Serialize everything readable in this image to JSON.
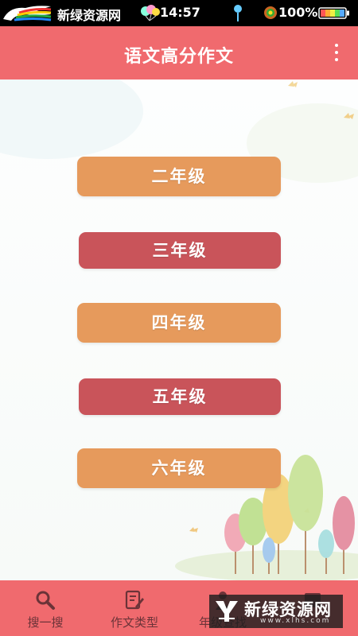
{
  "status_bar": {
    "site_name": "新绿资源网",
    "time": "14:57",
    "battery_percent": "100%",
    "icons": [
      "horse-logo-icon",
      "balloons-icon",
      "location-pin-icon",
      "signal-icon",
      "battery-icon"
    ]
  },
  "app_bar": {
    "title": "语文高分作文",
    "menu_icon": "more-vertical-icon"
  },
  "grades": [
    {
      "label": "二年级",
      "color": "#e69a5c"
    },
    {
      "label": "三年级",
      "color": "#c9545a"
    },
    {
      "label": "四年级",
      "color": "#e69a5c"
    },
    {
      "label": "五年级",
      "color": "#c9545a"
    },
    {
      "label": "六年级",
      "color": "#e69a5c"
    }
  ],
  "bottom_nav": {
    "items": [
      {
        "label": "搜一搜",
        "icon": "search-icon"
      },
      {
        "label": "作文类型",
        "icon": "edit-document-icon"
      },
      {
        "label": "年级查找",
        "icon": "person-icon"
      },
      {
        "label": "",
        "icon": "book-icon"
      }
    ]
  },
  "watermark": {
    "text": "新绿资源网",
    "url": "www.xlhs.com"
  },
  "colors": {
    "primary": "#f06a6e",
    "orange_button": "#e69a5c",
    "red_button": "#c9545a",
    "nav_text": "#6b3338"
  }
}
